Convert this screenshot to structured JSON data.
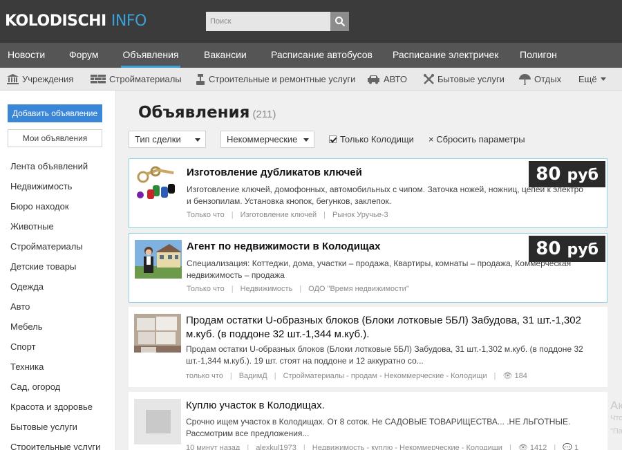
{
  "logo": {
    "part1": "KOLODISCHI",
    "part2": "INFO"
  },
  "search": {
    "placeholder": "Поиск"
  },
  "main_nav": [
    {
      "label": "Новости"
    },
    {
      "label": "Форум"
    },
    {
      "label": "Объявления",
      "active": true
    },
    {
      "label": "Вакансии"
    },
    {
      "label": "Расписание автобусов"
    },
    {
      "label": "Расписание электричек"
    },
    {
      "label": "Полигон"
    }
  ],
  "sub_nav": [
    {
      "label": "Учреждения",
      "icon": "institution-icon"
    },
    {
      "label": "Стройматериалы",
      "icon": "bricks-icon"
    },
    {
      "label": "Строительные и ремонтные услуги",
      "icon": "paint-roller-icon"
    },
    {
      "label": "АВТО",
      "icon": "car-icon"
    },
    {
      "label": "Бытовые услуги",
      "icon": "tools-icon"
    },
    {
      "label": "Отдых",
      "icon": "umbrella-icon"
    },
    {
      "label": "Ещё",
      "icon": "chevron-down-icon"
    }
  ],
  "sidebar": {
    "add_button": "Добавить объявление",
    "my_button": "Мои объявления",
    "categories": [
      "Лента объявлений",
      "Недвижимость",
      "Бюро находок",
      "Животные",
      "Стройматериалы",
      "Детские товары",
      "Одежда",
      "Авто",
      "Мебель",
      "Спорт",
      "Техника",
      "Сад, огород",
      "Красота и здоровье",
      "Бытовые услуги",
      "Строительные услуги"
    ]
  },
  "page": {
    "title": "Объявления",
    "count": "(211)"
  },
  "filters": {
    "deal_type": "Тип сделки",
    "commercial": "Некоммерческие",
    "only_label": "Только Колодищи",
    "only_checked": true,
    "reset": "Сбросить параметры"
  },
  "listings": [
    {
      "title": "Изготовление дубликатов ключей",
      "price": "80",
      "currency": "руб",
      "desc1": "Изготовление ключей, домофонных, автомобильных с чипом. Заточка ножей, ножниц, цепей к электро",
      "desc2": "и бензопилам. Установка кнопок, бегунков, заклепок.",
      "time": "Только что",
      "category": "Изготовление ключей",
      "location": "Рынок Уручье-3"
    },
    {
      "title": "Агент по недвижимости в Колодищах",
      "price": "80",
      "currency": "руб",
      "desc1": "Специализация: Коттеджи, дома, участки – продажа, Квартиры, комнаты – продажа, Коммерческая",
      "desc2": "недвижимость – продажа",
      "time": "Только что",
      "category": "Недвижимость",
      "location": "ОДО \"Время недвижимости\""
    },
    {
      "title1": "Продам остатки U-образных блоков (Блоки лотковые 5БЛ) Забудова, 31 шт.-1,302",
      "title2": "м.куб. (в поддоне 32 шт.-1,344 м.куб.).",
      "desc1": "Продам остатки U-образных блоков (Блоки лотковые 5БЛ) Забудова, 31 шт.-1,302 м.куб. (в поддоне 32",
      "desc2": "шт.-1,344 м.куб.). 19 шт. стоят на поддоне и 12 аккуратно со...",
      "time": "только что",
      "author": "ВадимД",
      "category": "Стройматериалы - продам - Некоммерческие - Колодищи",
      "views": "184"
    },
    {
      "title": "Куплю участок в Колодищах.",
      "desc1": "Срочно ищем участок в Колодищах. От 8 соток. Не САДОВЫЕ ТОВАРИЩЕСТВА... .НЕ ЛЬГОТНЫЕ.",
      "desc2": "Рассмотрим все предложения...",
      "time": "10 минут назад",
      "author": "alexkul1973",
      "category": "Недвижимость - куплю - Некоммерческие - Колодищи",
      "views": "1412",
      "comments": "1"
    }
  ],
  "ghost": {
    "big": "Ак",
    "line1": "Что",
    "line2": "\"Па"
  }
}
